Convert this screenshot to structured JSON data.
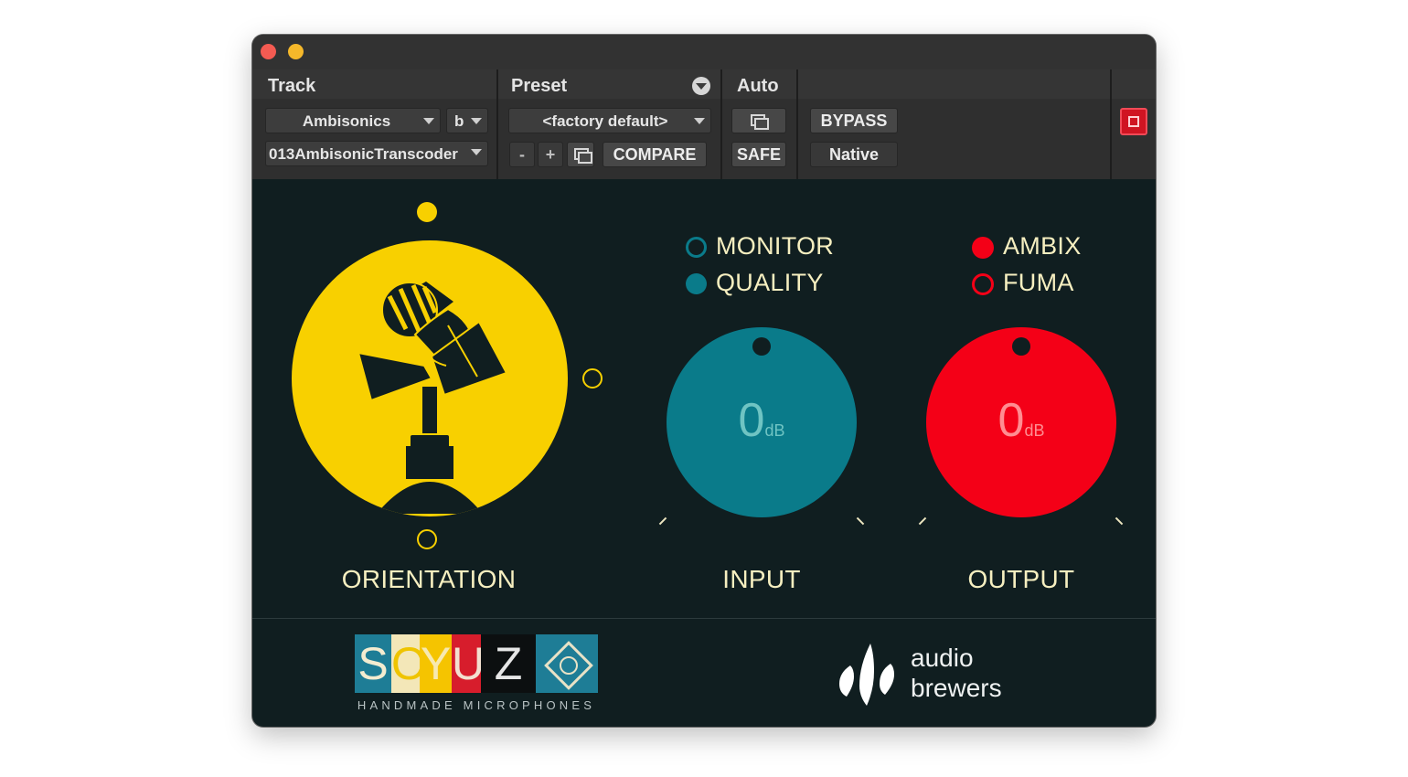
{
  "header": {
    "track_label": "Track",
    "preset_label": "Preset",
    "auto_label": "Auto"
  },
  "track": {
    "type_value": "Ambisonics",
    "channel_value": "b",
    "plugin_value": "013AmbisonicTranscoder"
  },
  "preset": {
    "value": "<factory default>",
    "minus_label": "-",
    "plus_label": "+",
    "compare_label": "COMPARE"
  },
  "auto": {
    "safe_label": "SAFE"
  },
  "bypass": {
    "bypass_label": "BYPASS",
    "native_label": "Native"
  },
  "colors": {
    "panel_bg": "#101e20",
    "accent_yellow": "#f8d000",
    "accent_teal": "#0a7b8a",
    "accent_red": "#f40017",
    "label_text": "#f6efc0"
  },
  "controls": {
    "orientation_label": "ORIENTATION",
    "input_label": "INPUT",
    "output_label": "OUTPUT",
    "input_value": "0",
    "input_unit": "dB",
    "output_value": "0",
    "output_unit": "dB"
  },
  "options": {
    "monitor_label": "MONITOR",
    "quality_label": "QUALITY",
    "ambix_label": "AMBIX",
    "fuma_label": "FUMA",
    "selected_input_mode": "QUALITY",
    "selected_output_format": "AMBIX"
  },
  "branding": {
    "soyuz_letters": [
      "S",
      "O",
      "Y",
      "U",
      "Z"
    ],
    "soyuz_tagline": "HANDMADE MICROPHONES",
    "brewers_line1": "audio",
    "brewers_line2": "brewers"
  }
}
